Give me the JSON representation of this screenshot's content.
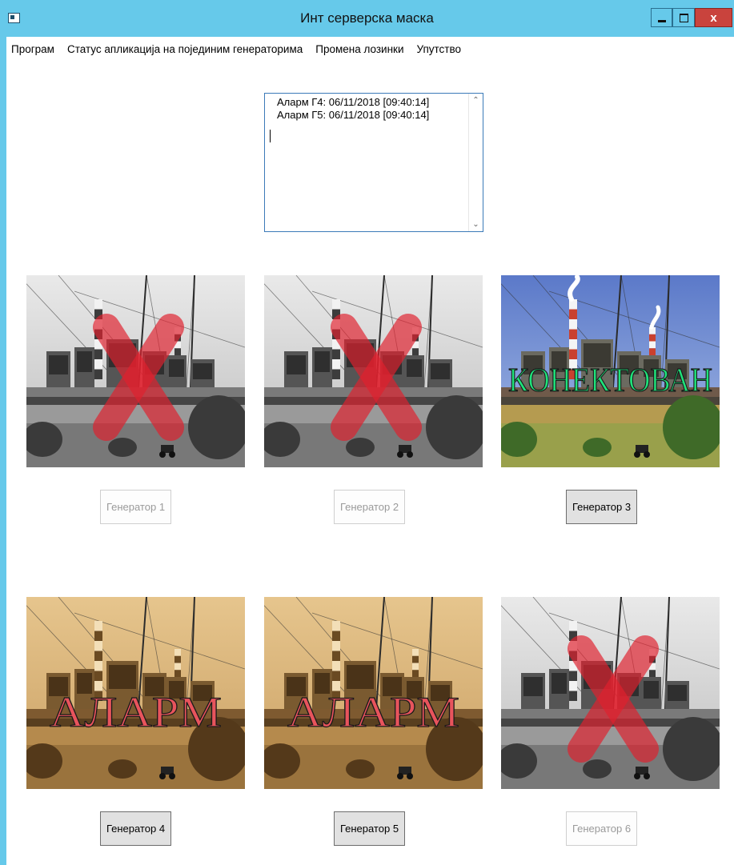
{
  "window": {
    "title": "Инт серверска маска",
    "close_label": "x"
  },
  "menu": [
    {
      "label": "Програм"
    },
    {
      "label": "Статус апликација на појединим генераторима"
    },
    {
      "label": "Промена лозинки"
    },
    {
      "label": "Упутство"
    }
  ],
  "alarm_log": {
    "lines": [
      "Аларм Г4: 06/11/2018 [09:40:14]",
      "Аларм Г5: 06/11/2018 [09:40:14]"
    ],
    "scroll_up_icon": "chevron-up-icon",
    "scroll_down_icon": "chevron-down-icon"
  },
  "generators": [
    {
      "label": "Генератор 1",
      "enabled": false,
      "state": "disconnected",
      "overlay_text": ""
    },
    {
      "label": "Генератор 2",
      "enabled": false,
      "state": "disconnected",
      "overlay_text": ""
    },
    {
      "label": "Генератор 3",
      "enabled": true,
      "state": "connected",
      "overlay_text": "КОНЕКТОВАН"
    },
    {
      "label": "Генератор 4",
      "enabled": true,
      "state": "alarm",
      "overlay_text": "АЛАРМ"
    },
    {
      "label": "Генератор 5",
      "enabled": true,
      "state": "alarm",
      "overlay_text": "АЛАРМ"
    },
    {
      "label": "Генератор 6",
      "enabled": false,
      "state": "disconnected",
      "overlay_text": ""
    }
  ],
  "colors": {
    "titlebar": "#66c9ea",
    "close_button": "#c9433d",
    "disconnected_x": "#e0202d",
    "connected_text": "#1fe37a",
    "alarm_text": "#e8545c"
  }
}
